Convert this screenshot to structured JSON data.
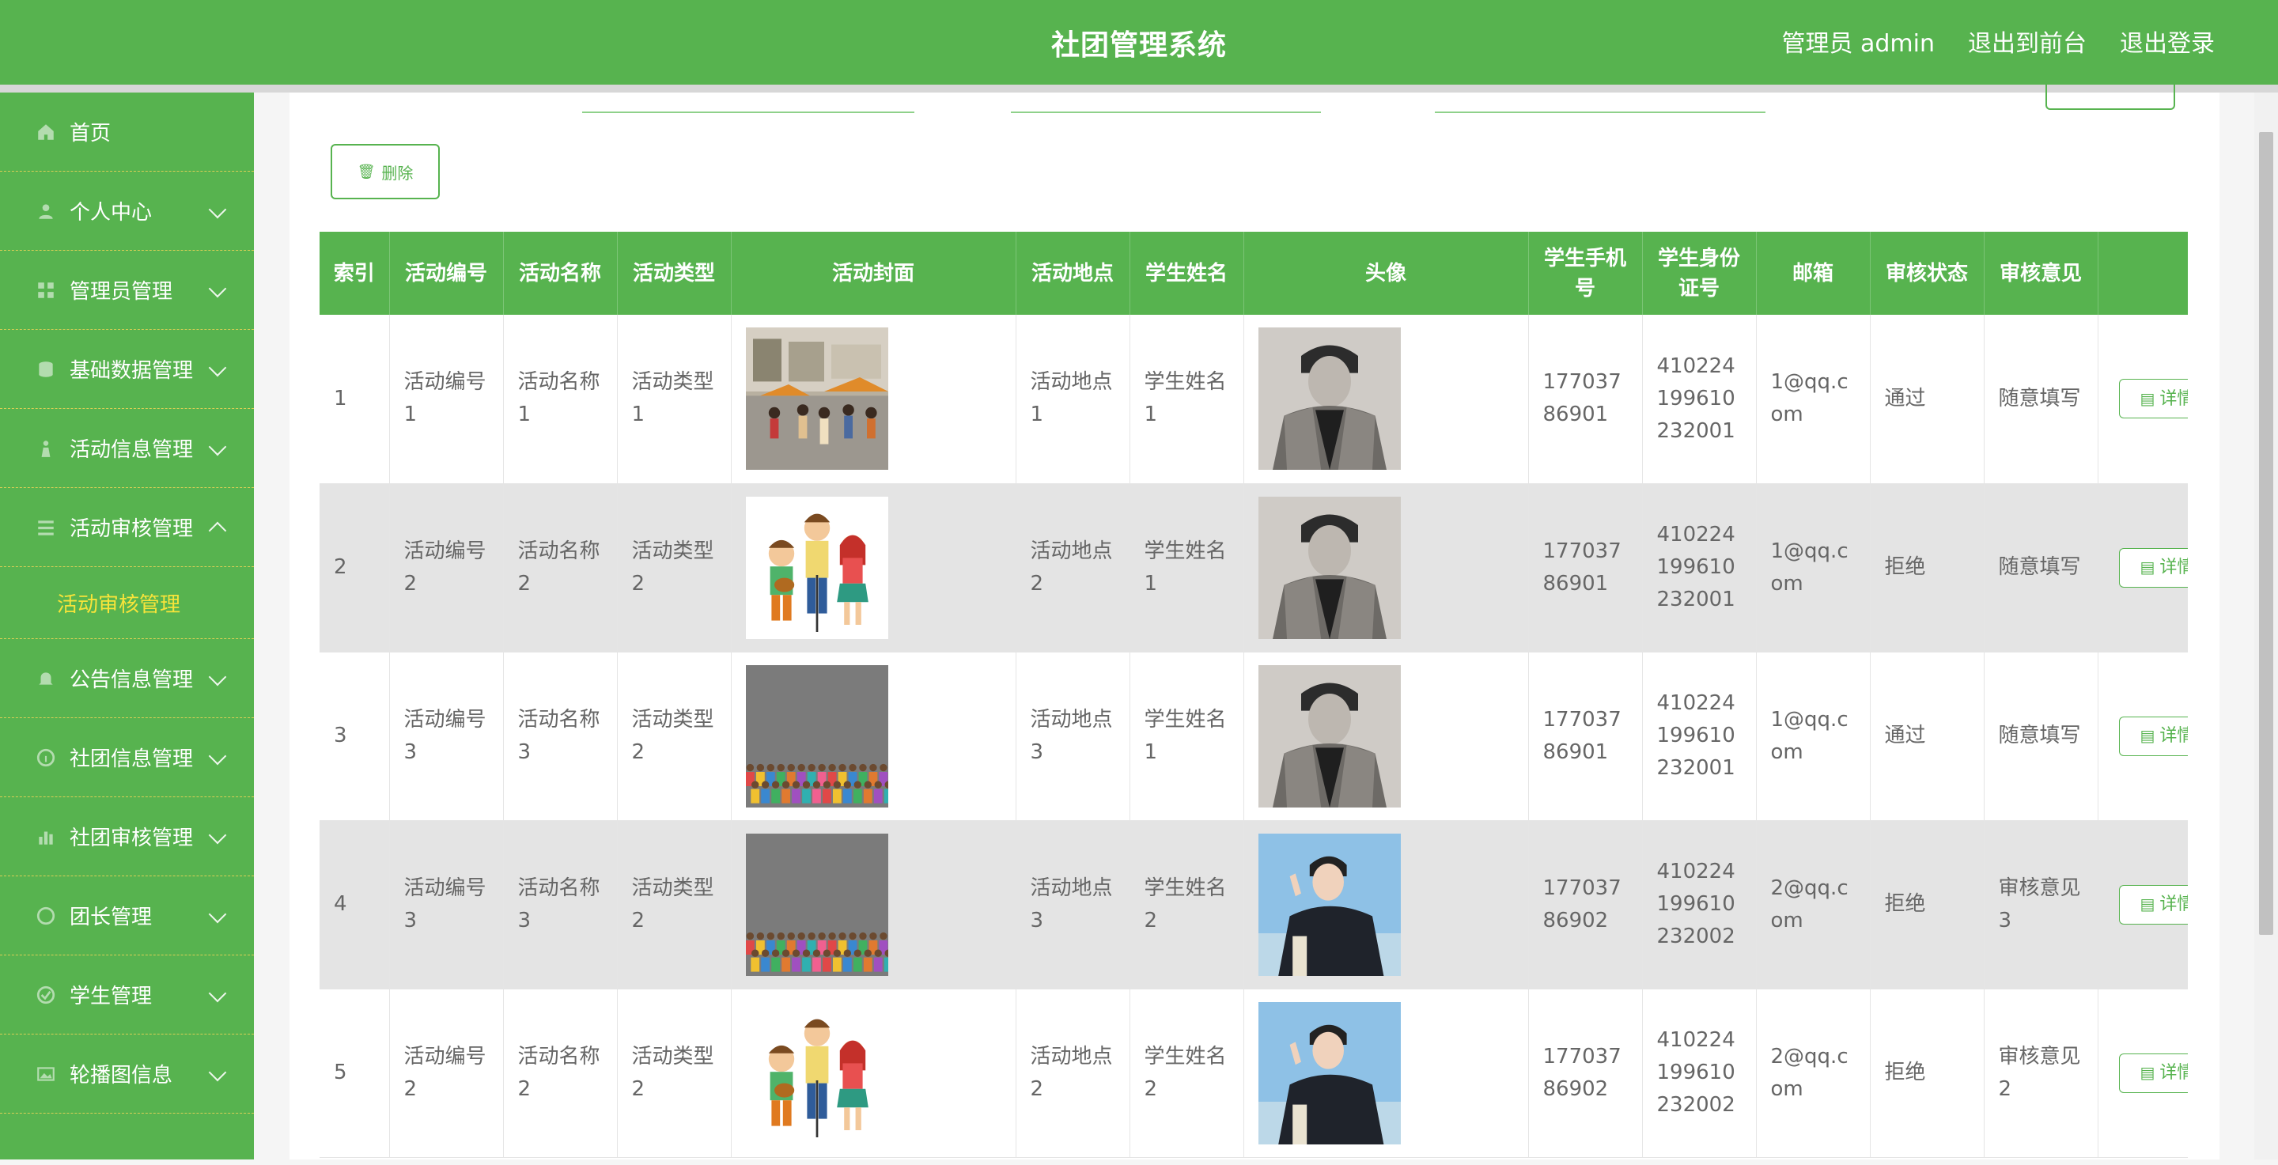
{
  "header": {
    "title": "社团管理系统",
    "user": "管理员 admin",
    "to_front": "退出到前台",
    "logout": "退出登录"
  },
  "sidebar": {
    "items": [
      {
        "label": "首页",
        "icon": "home-icon"
      },
      {
        "label": "个人中心",
        "icon": "user-icon"
      },
      {
        "label": "管理员管理",
        "icon": "grid-icon"
      },
      {
        "label": "基础数据管理",
        "icon": "database-icon"
      },
      {
        "label": "活动信息管理",
        "icon": "person-icon"
      },
      {
        "label": "活动审核管理",
        "icon": "list-icon"
      },
      {
        "label": "公告信息管理",
        "icon": "bell-icon"
      },
      {
        "label": "社团信息管理",
        "icon": "info-icon"
      },
      {
        "label": "社团审核管理",
        "icon": "bar-chart-icon"
      },
      {
        "label": "团长管理",
        "icon": "badge-icon"
      },
      {
        "label": "学生管理",
        "icon": "check-icon"
      },
      {
        "label": "轮播图信息",
        "icon": "image-icon"
      }
    ],
    "submenu_active": "活动审核管理"
  },
  "toolbar": {
    "delete_label": "删除"
  },
  "table": {
    "headers": [
      "索引",
      "活动编号",
      "活动名称",
      "活动类型",
      "活动封面",
      "活动地点",
      "学生姓名",
      "头像",
      "学生手机号",
      "学生身份证号",
      "邮箱",
      "审核状态",
      "审核意见",
      ""
    ],
    "detail_label": "详情",
    "rows": [
      {
        "index": "1",
        "code": "活动编号1",
        "name": "活动名称1",
        "type": "活动类型1",
        "cover": "street-event",
        "place": "活动地点1",
        "student": "学生姓名1",
        "avatar": "male-coat",
        "phone": "17703786901",
        "id_card": "410224199610232001",
        "email": "1@qq.com",
        "status": "通过",
        "opinion": "随意填写"
      },
      {
        "index": "2",
        "code": "活动编号2",
        "name": "活动名称2",
        "type": "活动类型2",
        "cover": "cartoon-band",
        "place": "活动地点2",
        "student": "学生姓名1",
        "avatar": "male-coat",
        "phone": "17703786901",
        "id_card": "410224199610232001",
        "email": "1@qq.com",
        "status": "拒绝",
        "opinion": "随意填写"
      },
      {
        "index": "3",
        "code": "活动编号3",
        "name": "活动名称3",
        "type": "活动类型2",
        "cover": "crowd",
        "place": "活动地点3",
        "student": "学生姓名1",
        "avatar": "male-coat",
        "phone": "17703786901",
        "id_card": "410224199610232001",
        "email": "1@qq.com",
        "status": "通过",
        "opinion": "随意填写"
      },
      {
        "index": "4",
        "code": "活动编号3",
        "name": "活动名称3",
        "type": "活动类型2",
        "cover": "crowd",
        "place": "活动地点3",
        "student": "学生姓名2",
        "avatar": "male-jacket",
        "phone": "17703786902",
        "id_card": "410224199610232002",
        "email": "2@qq.com",
        "status": "拒绝",
        "opinion": "审核意见3"
      },
      {
        "index": "5",
        "code": "活动编号2",
        "name": "活动名称2",
        "type": "活动类型2",
        "cover": "cartoon-band",
        "place": "活动地点2",
        "student": "学生姓名2",
        "avatar": "male-jacket",
        "phone": "17703786902",
        "id_card": "410224199610232002",
        "email": "2@qq.com",
        "status": "拒绝",
        "opinion": "审核意见2"
      }
    ]
  },
  "colors": {
    "primary": "#57b34f",
    "submenu_active": "#f7e43a"
  }
}
